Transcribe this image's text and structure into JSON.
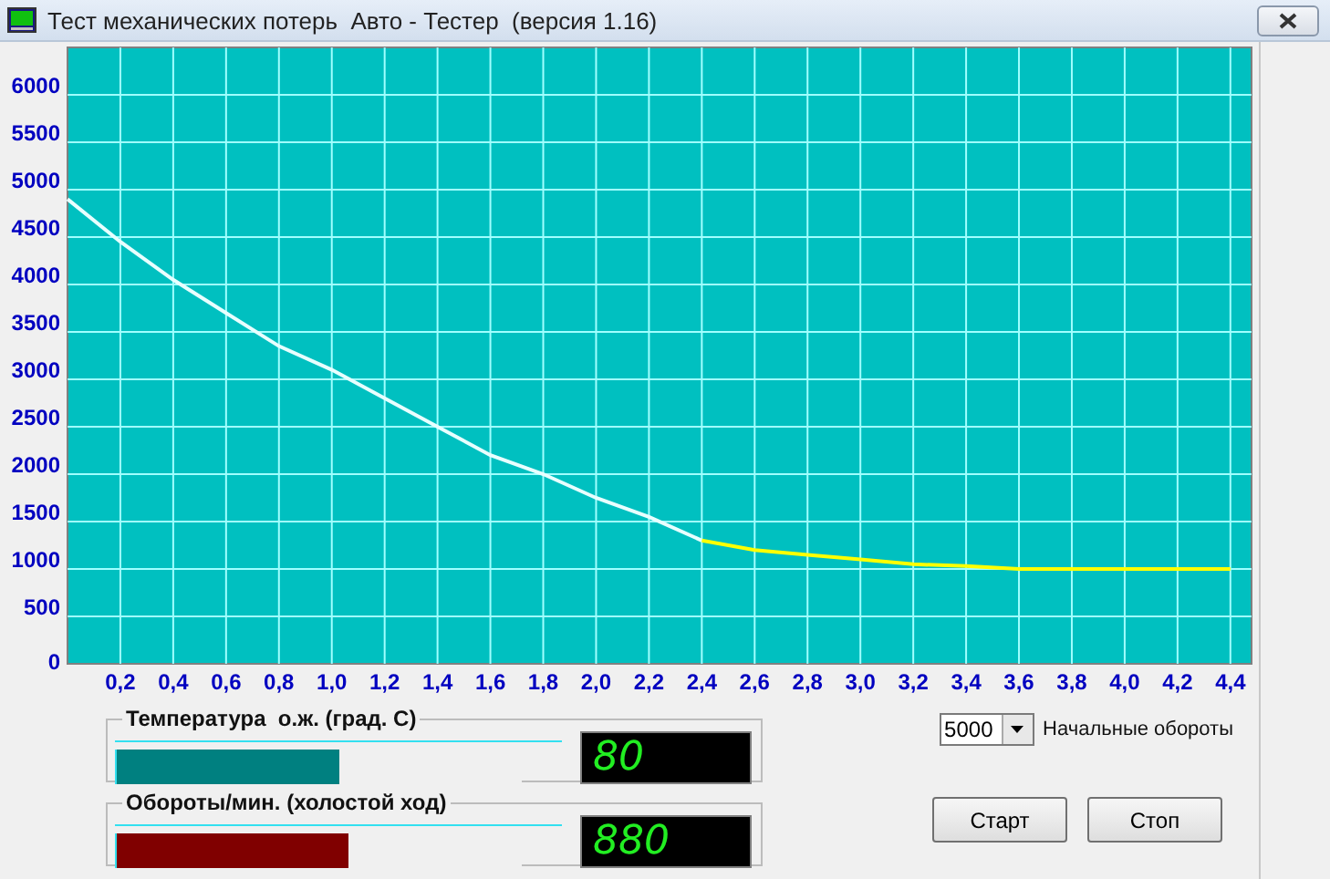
{
  "window": {
    "title": "Тест механических потерь  Авто - Тестер  (версия 1.16)"
  },
  "chart": {
    "chart_data": {
      "type": "line",
      "x": [
        0,
        0.2,
        0.4,
        0.6,
        0.8,
        1.0,
        1.2,
        1.4,
        1.6,
        1.8,
        2.0,
        2.2,
        2.4,
        2.6,
        2.8,
        3.0,
        3.2,
        3.4,
        3.6,
        3.8,
        4.0,
        4.2,
        4.4
      ],
      "series": [
        {
          "color": "#e8ffff",
          "values": [
            4900,
            4450,
            4050,
            3700,
            3350,
            3100,
            2800,
            2500,
            2200,
            2000,
            1750,
            1550,
            1300,
            null,
            null,
            null,
            null,
            null,
            null,
            null,
            null,
            null,
            null
          ]
        },
        {
          "color": "#ffff00",
          "values": [
            null,
            null,
            null,
            null,
            null,
            null,
            null,
            null,
            null,
            null,
            null,
            null,
            1300,
            1200,
            1150,
            1100,
            1050,
            1030,
            1000,
            1000,
            1000,
            1000,
            1000
          ]
        }
      ],
      "xlim": [
        0,
        4.48
      ],
      "grid": true,
      "ylim": [
        0,
        6500
      ],
      "xticks": [
        {
          "value": 0.2,
          "label": "0,2"
        },
        {
          "value": 0.4,
          "label": "0,4"
        },
        {
          "value": 0.6,
          "label": "0,6"
        },
        {
          "value": 0.8,
          "label": "0,8"
        },
        {
          "value": 1.0,
          "label": "1,0"
        },
        {
          "value": 1.2,
          "label": "1,2"
        },
        {
          "value": 1.4,
          "label": "1,4"
        },
        {
          "value": 1.6,
          "label": "1,6"
        },
        {
          "value": 1.8,
          "label": "1,8"
        },
        {
          "value": 2.0,
          "label": "2,0"
        },
        {
          "value": 2.2,
          "label": "2,2"
        },
        {
          "value": 2.4,
          "label": "2,4"
        },
        {
          "value": 2.6,
          "label": "2,6"
        },
        {
          "value": 2.8,
          "label": "2,8"
        },
        {
          "value": 3.0,
          "label": "3,0"
        },
        {
          "value": 3.2,
          "label": "3,2"
        },
        {
          "value": 3.4,
          "label": "3,4"
        },
        {
          "value": 3.6,
          "label": "3,6"
        },
        {
          "value": 3.8,
          "label": "3,8"
        },
        {
          "value": 4.0,
          "label": "4,0"
        },
        {
          "value": 4.2,
          "label": "4,2"
        },
        {
          "value": 4.4,
          "label": "4,4"
        }
      ],
      "yticks": [
        0,
        500,
        1000,
        1500,
        2000,
        2500,
        3000,
        3500,
        4000,
        4500,
        5000,
        5500,
        6000
      ]
    }
  },
  "gauges": [
    {
      "label": "Температура  о.ж. (град. С)",
      "level": 0.55,
      "color": "#008080",
      "reading": "80"
    },
    {
      "label": "Обороты/мин. (холостой ход)",
      "level": 0.57,
      "color": "#800000",
      "reading": "880"
    }
  ],
  "start_rpm": {
    "value": "5000",
    "label": "Начальные обороты"
  },
  "buttons": [
    "Старт",
    "Стоп"
  ]
}
